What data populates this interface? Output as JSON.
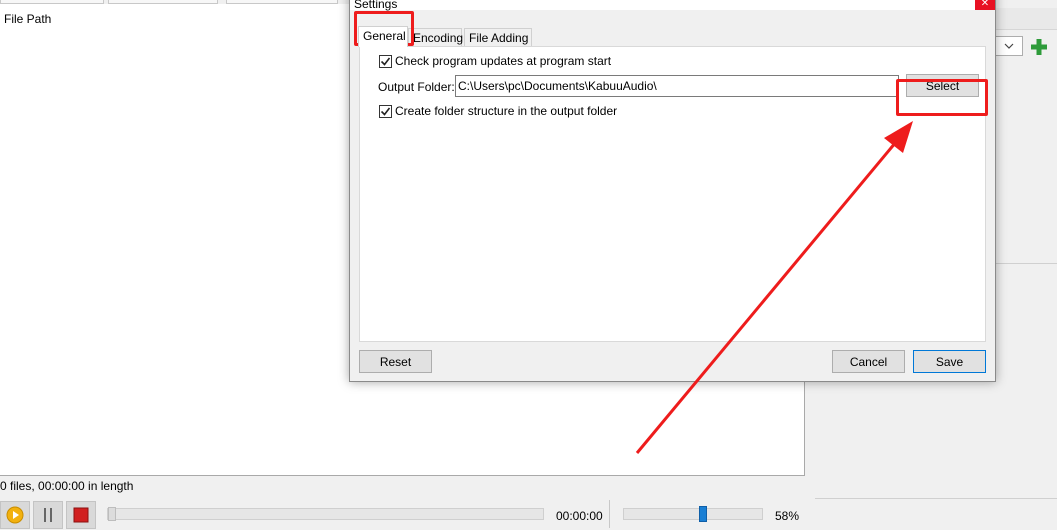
{
  "background_app": {
    "list": {
      "column_header": "File Path"
    },
    "status_text": "0 files, 00:00:00 in length",
    "player": {
      "time": "00:00:00",
      "seek_position": 0,
      "volume": 0.58,
      "volume_label": "58%"
    }
  },
  "dialog": {
    "title": "Settings",
    "tabs": [
      {
        "label": "General"
      },
      {
        "label": "Encoding"
      },
      {
        "label": "File Adding"
      }
    ],
    "active_tab": "General",
    "general": {
      "check_updates_label": "Check program updates at program start",
      "check_updates_checked": true,
      "output_folder_label": "Output Folder:",
      "output_folder_value": "C:\\Users\\pc\\Documents\\KabuuAudio\\",
      "select_label": "Select",
      "create_structure_label": "Create folder structure in the output folder",
      "create_structure_checked": true
    },
    "buttons": {
      "reset": "Reset",
      "cancel": "Cancel",
      "save": "Save"
    }
  },
  "colors": {
    "highlight": "#ee1c1c",
    "volume_knob": "#1a7fd4",
    "add_icon": "#2e9b3a",
    "play_icon": "#f2b10f",
    "stop_icon": "#d11f1f"
  },
  "icons": [
    "close-icon",
    "chevron-down-icon",
    "plus-icon",
    "play-icon",
    "pause-icon",
    "stop-icon",
    "checkmark-icon"
  ]
}
